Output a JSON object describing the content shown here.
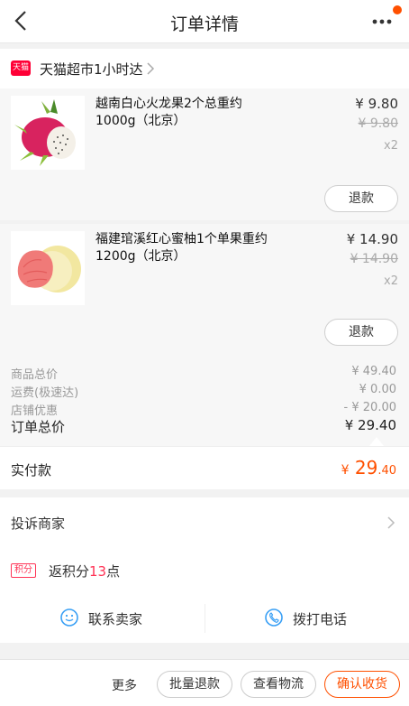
{
  "nav": {
    "title": "订单详情"
  },
  "shop": {
    "logo_text": "天猫",
    "name": "天猫超市1小时达"
  },
  "items": [
    {
      "name": "越南白心火龙果2个总重约1000g（北京）",
      "price": "¥ 9.80",
      "original_price": "¥ 9.80",
      "qty": "x2",
      "refund_label": "退款"
    },
    {
      "name": "福建琯溪红心蜜柚1个单果重约1200g（北京）",
      "price": "¥ 14.90",
      "original_price": "¥ 14.90",
      "qty": "x2",
      "refund_label": "退款"
    }
  ],
  "summary": {
    "goods_total_label": "商品总价",
    "goods_total": "¥ 49.40",
    "shipping_label": "运费(极速达)",
    "shipping": "¥ 0.00",
    "discount_label": "店铺优惠",
    "discount": "- ¥ 20.00",
    "order_total_label": "订单总价",
    "order_total": "¥ 29.40"
  },
  "paid": {
    "label": "实付款",
    "currency": "¥",
    "int": "29",
    "dec": ".40"
  },
  "complain": {
    "label": "投诉商家"
  },
  "points": {
    "badge": "积分",
    "prefix": "返积分",
    "amount": "13",
    "suffix": "点"
  },
  "contact": {
    "seller_label": "联系卖家",
    "phone_label": "拨打电话"
  },
  "bottom": {
    "more": "更多",
    "batch_refund": "批量退款",
    "logistics": "查看物流",
    "confirm": "确认收货"
  },
  "colors": {
    "accent": "#ff5000",
    "tmall_red": "#ff0036",
    "points_red": "#ff3355"
  },
  "icons": [
    "back-icon",
    "more-dots-icon",
    "tmall-logo-icon",
    "chevron-right-icon",
    "chat-face-icon",
    "phone-icon"
  ]
}
